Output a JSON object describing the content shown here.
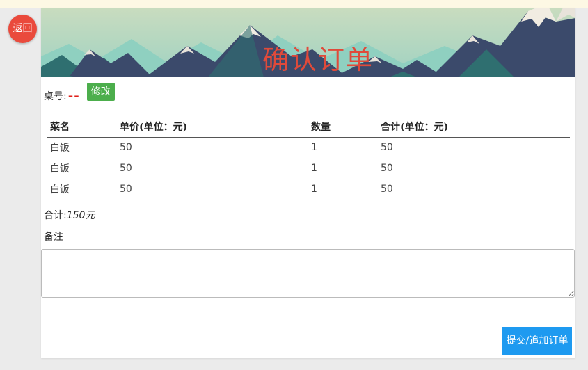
{
  "back_button": {
    "label": "返回"
  },
  "header": {
    "title": "确认订单"
  },
  "table_info": {
    "label": "桌号:",
    "value": "--",
    "modify_label": "修改"
  },
  "order_table": {
    "headers": [
      "菜名",
      "单价(单位：元)",
      "数量",
      "合计(单位：元)"
    ],
    "rows": [
      [
        "白饭",
        "50",
        "1",
        "50"
      ],
      [
        "白饭",
        "50",
        "1",
        "50"
      ],
      [
        "白饭",
        "50",
        "1",
        "50"
      ]
    ]
  },
  "summary": {
    "total_label": "合计:",
    "total_value": "150元"
  },
  "remark": {
    "label": "备注",
    "value": "",
    "placeholder": ""
  },
  "submit_button": {
    "label": "提交/追加订单"
  },
  "colors": {
    "accent_red": "#ea4a3c",
    "title_red": "#e04a3a",
    "modify_green": "#4cae4c",
    "submit_blue": "#1e9af0"
  }
}
